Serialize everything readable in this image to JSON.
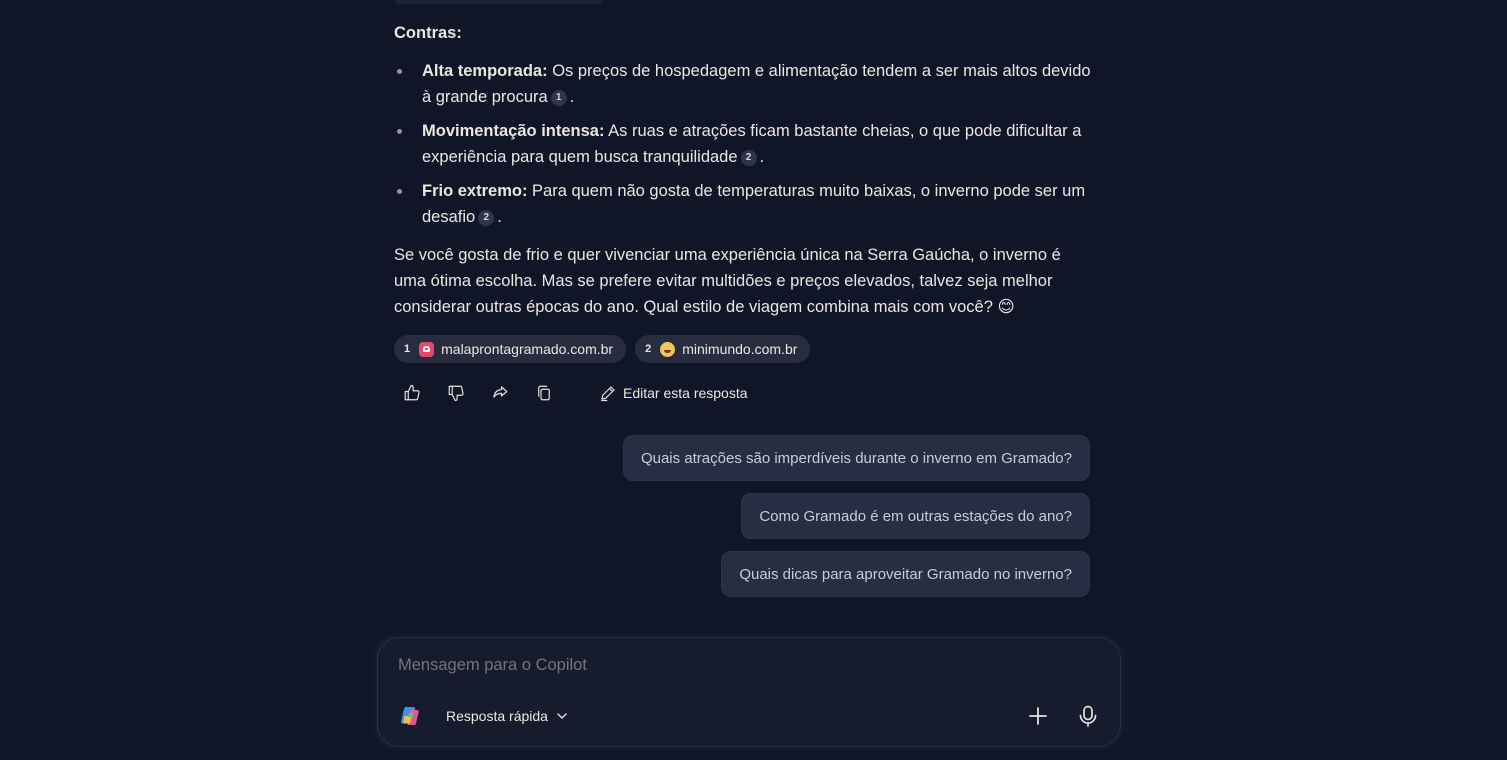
{
  "response": {
    "contras_heading": "Contras:",
    "bullets": [
      {
        "term": "Alta temporada:",
        "text": " Os preços de hospedagem e alimentação tendem a ser mais altos devido à grande procura",
        "cite": "1",
        "end": "."
      },
      {
        "term": "Movimentação intensa:",
        "text": " As ruas e atrações ficam bastante cheias, o que pode dificultar a experiência para quem busca tranquilidade",
        "cite": "2",
        "end": "."
      },
      {
        "term": "Frio extremo:",
        "text": " Para quem não gosta de temperaturas muito baixas, o inverno pode ser um desafio",
        "cite": "2",
        "end": "."
      }
    ],
    "summary": "Se você gosta de frio e quer vivenciar uma experiência única na Serra Gaúcha, o inverno é uma ótima escolha. Mas se prefere evitar multidões e preços elevados, talvez seja melhor considerar outras épocas do ano. Qual estilo de viagem combina mais com você? 😊"
  },
  "sources": [
    {
      "num": "1",
      "domain": "malaprontagramado.com.br"
    },
    {
      "num": "2",
      "domain": "minimundo.com.br"
    }
  ],
  "actions": {
    "icons": [
      "thumbs-up-icon",
      "thumbs-down-icon",
      "share-icon",
      "copy-icon"
    ],
    "edit_label": "Editar esta resposta"
  },
  "suggestions": [
    "Quais atrações são imperdíveis durante o inverno em Gramado?",
    "Como Gramado é em outras estações do ano?",
    "Quais dicas para aproveitar Gramado no inverno?"
  ],
  "composer": {
    "placeholder": "Mensagem para o Copilot",
    "mode_label": "Resposta rápida"
  }
}
